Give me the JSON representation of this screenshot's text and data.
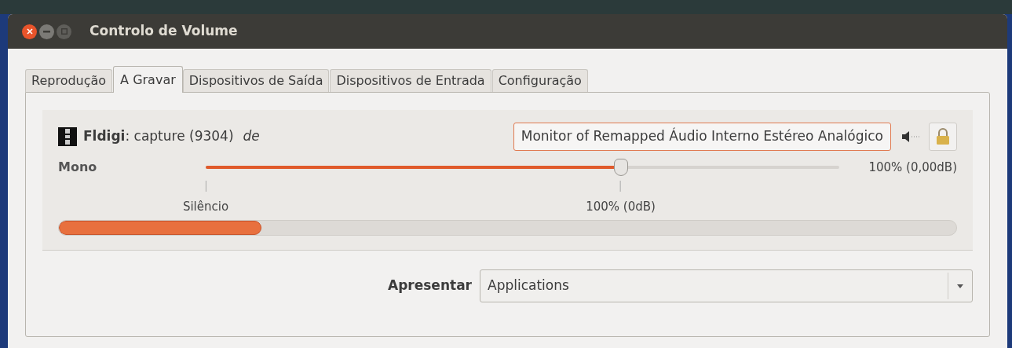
{
  "window": {
    "title": "Controlo de Volume"
  },
  "tabs": [
    {
      "label": "Reprodução",
      "selected": false
    },
    {
      "label": "A Gravar",
      "selected": true
    },
    {
      "label": "Dispositivos de Saída",
      "selected": false
    },
    {
      "label": "Dispositivos de Entrada",
      "selected": false
    },
    {
      "label": "Configuração",
      "selected": false
    }
  ],
  "stream": {
    "name": "**Fldigi**: capture (9304)",
    "connector": "de",
    "device": "Monitor of Remapped Áudio Interno Estéreo Analógico",
    "muted": false,
    "locked": true,
    "channel": {
      "name": "Mono",
      "level": 0.655,
      "reading": "100% (0,00dB)"
    },
    "marks": [
      {
        "label": "Silêncio"
      },
      {
        "label": "100% (0dB)"
      }
    ],
    "peak": {
      "level": 0.226
    }
  },
  "show": {
    "label": "Apresentar",
    "value": "Applications"
  }
}
